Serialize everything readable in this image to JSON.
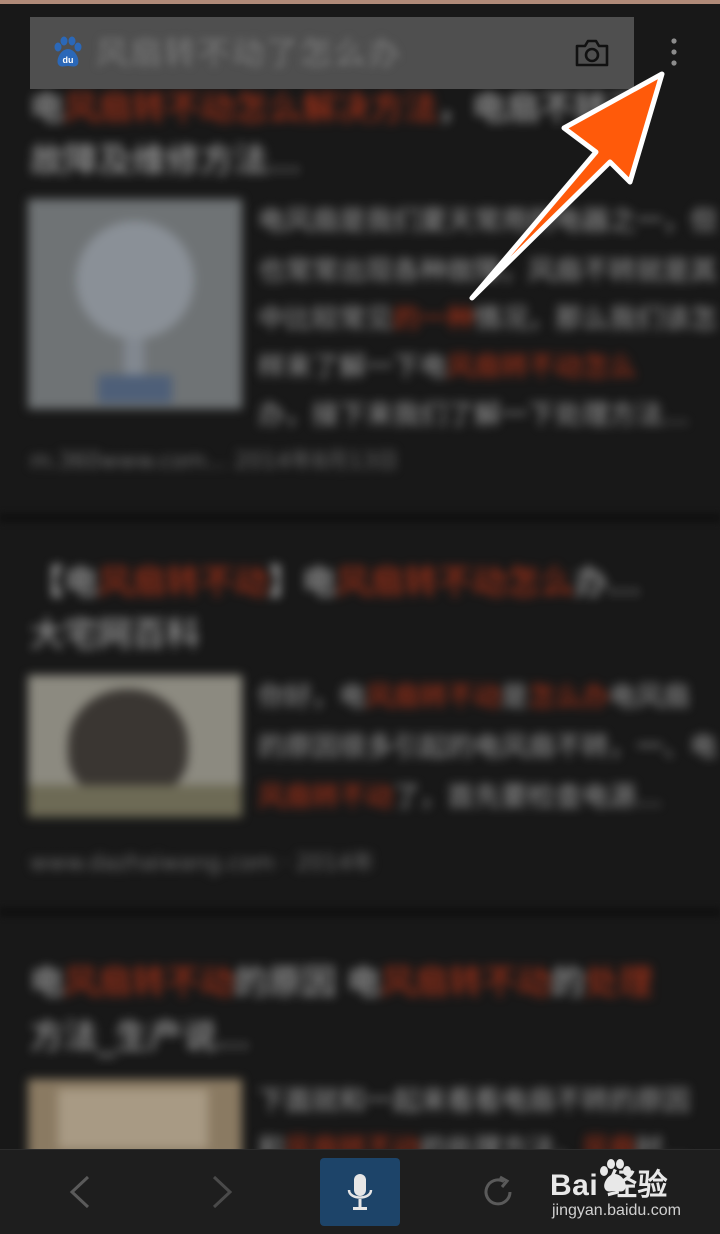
{
  "search": {
    "query": "风扇转不动了怎么办"
  },
  "icons": {
    "search_logo": "baidu-paw-icon",
    "camera": "camera-icon",
    "menu": "more-vertical-icon",
    "back": "chevron-left-icon",
    "forward": "chevron-right-icon",
    "voice": "microphone-icon",
    "refresh": "refresh-icon"
  },
  "watermark": {
    "brand": "Bai  经验",
    "url": "jingyan.baidu.com"
  },
  "colors": {
    "background": "#181818",
    "search_bar": "#4f4f4f",
    "highlight": "#b33418",
    "mic_button": "#1d4469",
    "arrow": "#ff5a0a"
  }
}
